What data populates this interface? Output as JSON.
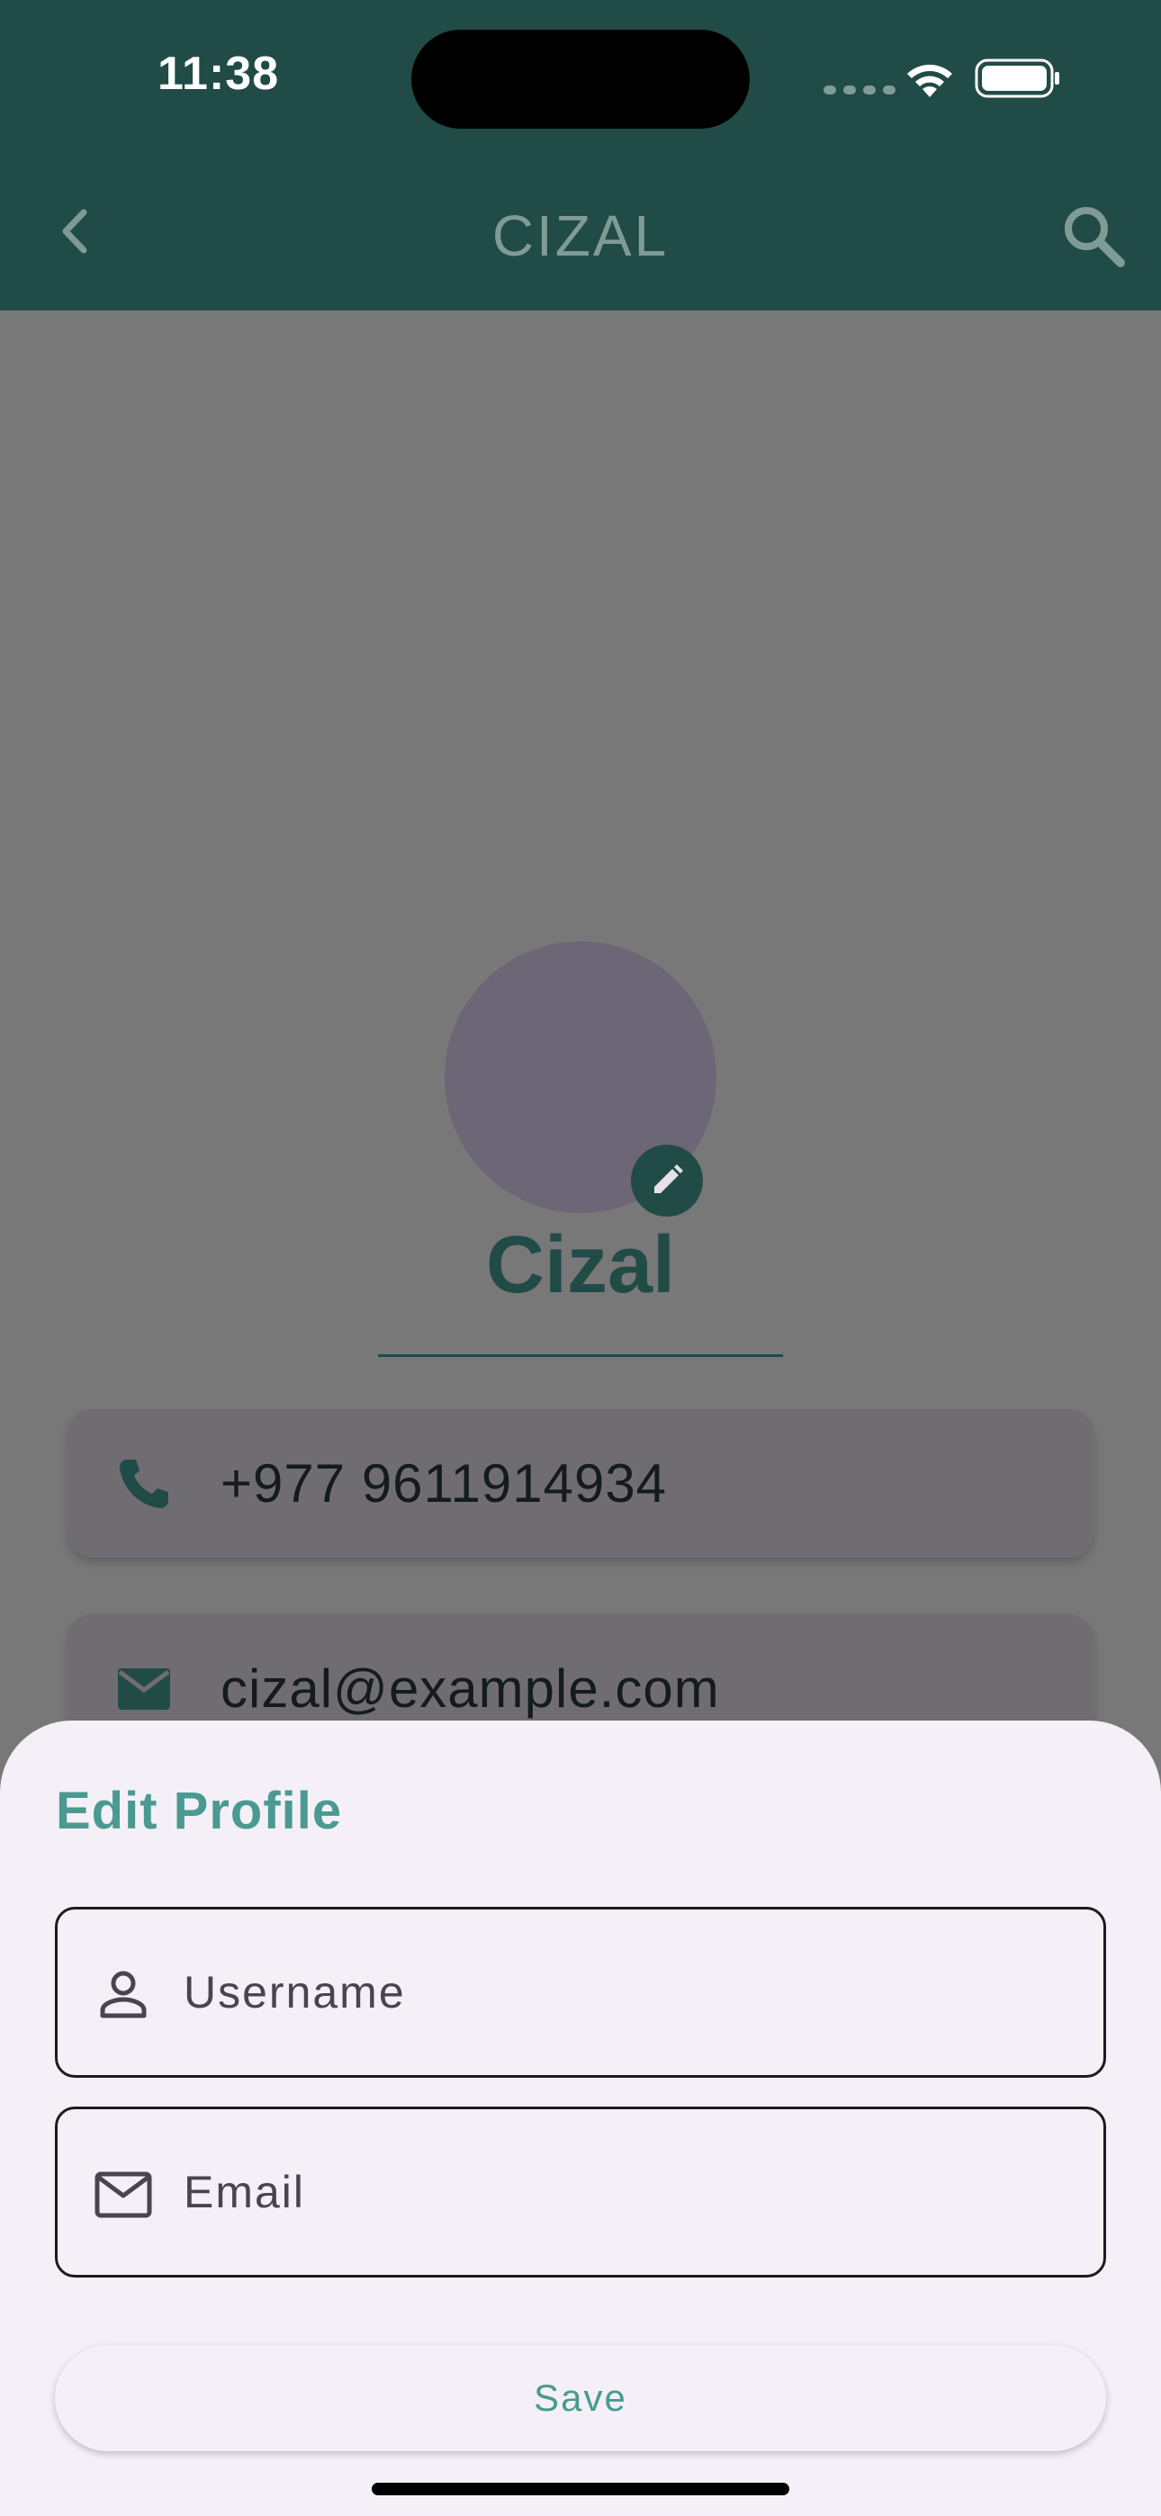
{
  "status_bar": {
    "time": "11:38"
  },
  "app_bar": {
    "title": "CIZAL",
    "back_icon": "chevron-left-icon",
    "search_icon": "search-icon"
  },
  "profile": {
    "name": "Cizal",
    "phone": "+977 9611914934",
    "email": "cizal@example.com"
  },
  "edit_sheet": {
    "title": "Edit Profile",
    "username_placeholder": "Username",
    "username_value": "",
    "email_placeholder": "Email",
    "email_value": "",
    "save_label": "Save"
  },
  "colors": {
    "primary": "#214b46",
    "accent": "#4a9a92",
    "sheet_background": "#f5f0f7",
    "scrim_background": "#787878"
  }
}
